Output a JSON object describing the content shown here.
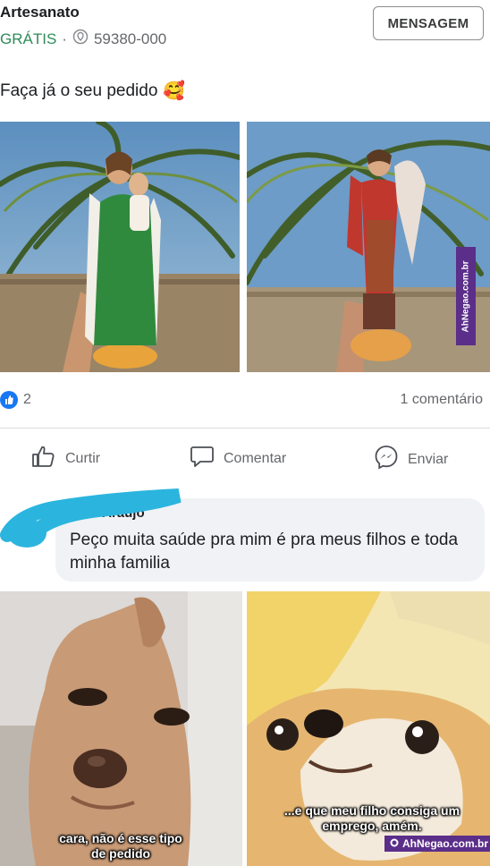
{
  "header": {
    "title": "Artesanato",
    "price": "GRÁTIS",
    "separator": "·",
    "location": "59380-000",
    "message_button": "MENSAGEM"
  },
  "post": {
    "text": "Faça já o seu pedido",
    "emoji": "🥰"
  },
  "reactions": {
    "count": "2",
    "comments": "1 comentário"
  },
  "actions": {
    "like": "Curtir",
    "comment": "Comentar",
    "send": "Enviar"
  },
  "comment": {
    "author": "... Araujo",
    "text": "Peço  muita saúde  pra mim é pra meus filhos e toda minha familia"
  },
  "watermark": {
    "vertical": "AhNegao.com.br",
    "bottom": "AhNegao.com.br"
  },
  "meme": {
    "left_caption": "cara, não é esse tipo de pedido",
    "right_caption": "...e que meu filho consiga um emprego, amém."
  },
  "colors": {
    "facebook_blue": "#1877f2",
    "free_green": "#2e8b57",
    "scribble_cyan": "#2bb5de",
    "watermark_purple": "#5b2e8a"
  }
}
